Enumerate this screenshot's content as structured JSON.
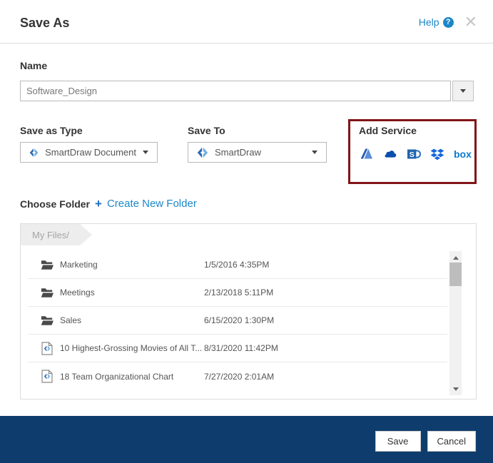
{
  "header": {
    "title": "Save As",
    "help_label": "Help"
  },
  "name_field": {
    "label": "Name",
    "value": "Software_Design"
  },
  "save_as_type": {
    "label": "Save as Type",
    "value": "SmartDraw Document"
  },
  "save_to": {
    "label": "Save To",
    "value": "SmartDraw"
  },
  "add_service": {
    "label": "Add Service",
    "services": [
      "google-drive",
      "onedrive",
      "sharepoint",
      "dropbox",
      "box"
    ],
    "box_wordmark": "box"
  },
  "choose_folder": {
    "label": "Choose Folder",
    "plus": "+",
    "create_new": "Create New Folder"
  },
  "folder_browser": {
    "tab": "My Files/",
    "files": [
      {
        "name": "Marketing",
        "date": "1/5/2016 4:35PM",
        "type": "folder"
      },
      {
        "name": "Meetings",
        "date": "2/13/2018 5:11PM",
        "type": "folder"
      },
      {
        "name": "Sales",
        "date": "6/15/2020 1:30PM",
        "type": "folder"
      },
      {
        "name": "10 Highest-Grossing Movies of All T...",
        "date": "8/31/2020 11:42PM",
        "type": "document"
      },
      {
        "name": "18 Team Organizational Chart",
        "date": "7/27/2020 2:01AM",
        "type": "document"
      }
    ]
  },
  "footer": {
    "save": "Save",
    "cancel": "Cancel"
  },
  "colors": {
    "accent_blue": "#1c86c8",
    "footer_navy": "#0e3d6d",
    "service_box_border": "#821418"
  }
}
